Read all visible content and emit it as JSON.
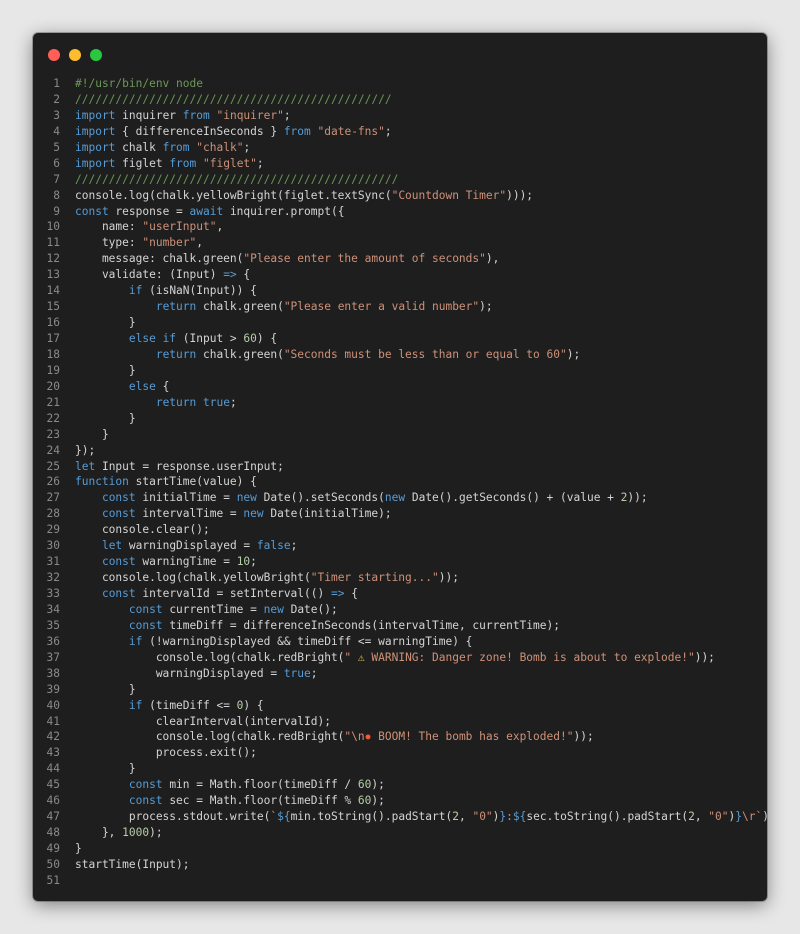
{
  "window": {
    "buttons": [
      {
        "name": "close",
        "color": "#ff5f57"
      },
      {
        "name": "minimize",
        "color": "#febc2e"
      },
      {
        "name": "maximize",
        "color": "#28c840"
      }
    ],
    "background": "#1e1e1e"
  },
  "code": {
    "lines": [
      {
        "num": "1",
        "tokens": [
          {
            "t": "#!/usr/bin/env node",
            "c": "comment"
          }
        ]
      },
      {
        "num": "2",
        "tokens": [
          {
            "t": "///////////////////////////////////////////////",
            "c": "comment"
          }
        ]
      },
      {
        "num": "3",
        "tokens": [
          {
            "t": "import",
            "c": "keyword"
          },
          {
            "t": " inquirer ",
            "c": "plain"
          },
          {
            "t": "from",
            "c": "keyword"
          },
          {
            "t": " ",
            "c": "plain"
          },
          {
            "t": "\"inquirer\"",
            "c": "string"
          },
          {
            "t": ";",
            "c": "plain"
          }
        ]
      },
      {
        "num": "4",
        "tokens": [
          {
            "t": "import",
            "c": "keyword"
          },
          {
            "t": " { differenceInSeconds } ",
            "c": "plain"
          },
          {
            "t": "from",
            "c": "keyword"
          },
          {
            "t": " ",
            "c": "plain"
          },
          {
            "t": "\"date-fns\"",
            "c": "string"
          },
          {
            "t": ";",
            "c": "plain"
          }
        ]
      },
      {
        "num": "5",
        "tokens": [
          {
            "t": "import",
            "c": "keyword"
          },
          {
            "t": " chalk ",
            "c": "plain"
          },
          {
            "t": "from",
            "c": "keyword"
          },
          {
            "t": " ",
            "c": "plain"
          },
          {
            "t": "\"chalk\"",
            "c": "string"
          },
          {
            "t": ";",
            "c": "plain"
          }
        ]
      },
      {
        "num": "6",
        "tokens": [
          {
            "t": "import",
            "c": "keyword"
          },
          {
            "t": " figlet ",
            "c": "plain"
          },
          {
            "t": "from",
            "c": "keyword"
          },
          {
            "t": " ",
            "c": "plain"
          },
          {
            "t": "\"figlet\"",
            "c": "string"
          },
          {
            "t": ";",
            "c": "plain"
          }
        ]
      },
      {
        "num": "7",
        "tokens": [
          {
            "t": "////////////////////////////////////////////////",
            "c": "comment"
          }
        ]
      },
      {
        "num": "8",
        "tokens": [
          {
            "t": "console.log(chalk.yellowBright(figlet.textSync(",
            "c": "plain"
          },
          {
            "t": "\"Countdown Timer\"",
            "c": "string"
          },
          {
            "t": ")));",
            "c": "plain"
          }
        ]
      },
      {
        "num": "9",
        "tokens": [
          {
            "t": "const",
            "c": "keyword"
          },
          {
            "t": " response = ",
            "c": "plain"
          },
          {
            "t": "await",
            "c": "keyword"
          },
          {
            "t": " inquirer.prompt({",
            "c": "plain"
          }
        ]
      },
      {
        "num": "10",
        "tokens": [
          {
            "t": "    name: ",
            "c": "plain"
          },
          {
            "t": "\"userInput\"",
            "c": "string"
          },
          {
            "t": ",",
            "c": "plain"
          }
        ]
      },
      {
        "num": "11",
        "tokens": [
          {
            "t": "    type: ",
            "c": "plain"
          },
          {
            "t": "\"number\"",
            "c": "string"
          },
          {
            "t": ",",
            "c": "plain"
          }
        ]
      },
      {
        "num": "12",
        "tokens": [
          {
            "t": "    message: chalk.green(",
            "c": "plain"
          },
          {
            "t": "\"Please enter the amount of seconds\"",
            "c": "string"
          },
          {
            "t": "),",
            "c": "plain"
          }
        ]
      },
      {
        "num": "13",
        "tokens": [
          {
            "t": "    validate: (Input) ",
            "c": "plain"
          },
          {
            "t": "=>",
            "c": "keyword"
          },
          {
            "t": " {",
            "c": "plain"
          }
        ]
      },
      {
        "num": "14",
        "tokens": [
          {
            "t": "        ",
            "c": "plain"
          },
          {
            "t": "if",
            "c": "control"
          },
          {
            "t": " (isNaN(Input)) {",
            "c": "plain"
          }
        ]
      },
      {
        "num": "15",
        "tokens": [
          {
            "t": "            ",
            "c": "plain"
          },
          {
            "t": "return",
            "c": "control"
          },
          {
            "t": " chalk.green(",
            "c": "plain"
          },
          {
            "t": "\"Please enter a valid number\"",
            "c": "string"
          },
          {
            "t": ");",
            "c": "plain"
          }
        ]
      },
      {
        "num": "16",
        "tokens": [
          {
            "t": "        }",
            "c": "plain"
          }
        ]
      },
      {
        "num": "17",
        "tokens": [
          {
            "t": "        ",
            "c": "plain"
          },
          {
            "t": "else if",
            "c": "control"
          },
          {
            "t": " (Input > ",
            "c": "plain"
          },
          {
            "t": "60",
            "c": "number"
          },
          {
            "t": ") {",
            "c": "plain"
          }
        ]
      },
      {
        "num": "18",
        "tokens": [
          {
            "t": "            ",
            "c": "plain"
          },
          {
            "t": "return",
            "c": "control"
          },
          {
            "t": " chalk.green(",
            "c": "plain"
          },
          {
            "t": "\"Seconds must be less than or equal to 60\"",
            "c": "string"
          },
          {
            "t": ");",
            "c": "plain"
          }
        ]
      },
      {
        "num": "19",
        "tokens": [
          {
            "t": "        }",
            "c": "plain"
          }
        ]
      },
      {
        "num": "20",
        "tokens": [
          {
            "t": "        ",
            "c": "plain"
          },
          {
            "t": "else",
            "c": "control"
          },
          {
            "t": " {",
            "c": "plain"
          }
        ]
      },
      {
        "num": "21",
        "tokens": [
          {
            "t": "            ",
            "c": "plain"
          },
          {
            "t": "return",
            "c": "control"
          },
          {
            "t": " ",
            "c": "plain"
          },
          {
            "t": "true",
            "c": "bool"
          },
          {
            "t": ";",
            "c": "plain"
          }
        ]
      },
      {
        "num": "22",
        "tokens": [
          {
            "t": "        }",
            "c": "plain"
          }
        ]
      },
      {
        "num": "23",
        "tokens": [
          {
            "t": "    }",
            "c": "plain"
          }
        ]
      },
      {
        "num": "24",
        "tokens": [
          {
            "t": "});",
            "c": "plain"
          }
        ]
      },
      {
        "num": "25",
        "tokens": [
          {
            "t": "let",
            "c": "keyword"
          },
          {
            "t": " Input = response.userInput;",
            "c": "plain"
          }
        ]
      },
      {
        "num": "26",
        "tokens": [
          {
            "t": "function",
            "c": "keyword"
          },
          {
            "t": " startTime(value) {",
            "c": "plain"
          }
        ]
      },
      {
        "num": "27",
        "tokens": [
          {
            "t": "    ",
            "c": "plain"
          },
          {
            "t": "const",
            "c": "keyword"
          },
          {
            "t": " initialTime = ",
            "c": "plain"
          },
          {
            "t": "new",
            "c": "keyword"
          },
          {
            "t": " Date().setSeconds(",
            "c": "plain"
          },
          {
            "t": "new",
            "c": "keyword"
          },
          {
            "t": " Date().getSeconds() + (value + ",
            "c": "plain"
          },
          {
            "t": "2",
            "c": "number"
          },
          {
            "t": "));",
            "c": "plain"
          }
        ]
      },
      {
        "num": "28",
        "tokens": [
          {
            "t": "    ",
            "c": "plain"
          },
          {
            "t": "const",
            "c": "keyword"
          },
          {
            "t": " intervalTime = ",
            "c": "plain"
          },
          {
            "t": "new",
            "c": "keyword"
          },
          {
            "t": " Date(initialTime);",
            "c": "plain"
          }
        ]
      },
      {
        "num": "29",
        "tokens": [
          {
            "t": "    console.clear();",
            "c": "plain"
          }
        ]
      },
      {
        "num": "30",
        "tokens": [
          {
            "t": "    ",
            "c": "plain"
          },
          {
            "t": "let",
            "c": "keyword"
          },
          {
            "t": " warningDisplayed = ",
            "c": "plain"
          },
          {
            "t": "false",
            "c": "bool"
          },
          {
            "t": ";",
            "c": "plain"
          }
        ]
      },
      {
        "num": "31",
        "tokens": [
          {
            "t": "    ",
            "c": "plain"
          },
          {
            "t": "const",
            "c": "keyword"
          },
          {
            "t": " warningTime = ",
            "c": "plain"
          },
          {
            "t": "10",
            "c": "number"
          },
          {
            "t": ";",
            "c": "plain"
          }
        ]
      },
      {
        "num": "32",
        "tokens": [
          {
            "t": "    console.log(chalk.yellowBright(",
            "c": "plain"
          },
          {
            "t": "\"Timer starting...\"",
            "c": "string"
          },
          {
            "t": "));",
            "c": "plain"
          }
        ]
      },
      {
        "num": "33",
        "tokens": [
          {
            "t": "    ",
            "c": "plain"
          },
          {
            "t": "const",
            "c": "keyword"
          },
          {
            "t": " intervalId = setInterval(() ",
            "c": "plain"
          },
          {
            "t": "=>",
            "c": "keyword"
          },
          {
            "t": " {",
            "c": "plain"
          }
        ]
      },
      {
        "num": "34",
        "tokens": [
          {
            "t": "        ",
            "c": "plain"
          },
          {
            "t": "const",
            "c": "keyword"
          },
          {
            "t": " currentTime = ",
            "c": "plain"
          },
          {
            "t": "new",
            "c": "keyword"
          },
          {
            "t": " Date();",
            "c": "plain"
          }
        ]
      },
      {
        "num": "35",
        "tokens": [
          {
            "t": "        ",
            "c": "plain"
          },
          {
            "t": "const",
            "c": "keyword"
          },
          {
            "t": " timeDiff = differenceInSeconds(intervalTime, currentTime);",
            "c": "plain"
          }
        ]
      },
      {
        "num": "36",
        "tokens": [
          {
            "t": "        ",
            "c": "plain"
          },
          {
            "t": "if",
            "c": "control"
          },
          {
            "t": " (!warningDisplayed && timeDiff <= warningTime) {",
            "c": "plain"
          }
        ]
      },
      {
        "num": "37",
        "tokens": [
          {
            "t": "            console.log(chalk.redBright(",
            "c": "plain"
          },
          {
            "t": "\" ",
            "c": "string"
          },
          {
            "t": "⚠",
            "c": "emoji"
          },
          {
            "t": " WARNING: Danger zone! Bomb is about to explode!\"",
            "c": "string"
          },
          {
            "t": "));",
            "c": "plain"
          }
        ]
      },
      {
        "num": "38",
        "tokens": [
          {
            "t": "            warningDisplayed = ",
            "c": "plain"
          },
          {
            "t": "true",
            "c": "bool"
          },
          {
            "t": ";",
            "c": "plain"
          }
        ]
      },
      {
        "num": "39",
        "tokens": [
          {
            "t": "        }",
            "c": "plain"
          }
        ]
      },
      {
        "num": "40",
        "tokens": [
          {
            "t": "        ",
            "c": "plain"
          },
          {
            "t": "if",
            "c": "control"
          },
          {
            "t": " (timeDiff <= ",
            "c": "plain"
          },
          {
            "t": "0",
            "c": "number"
          },
          {
            "t": ") {",
            "c": "plain"
          }
        ]
      },
      {
        "num": "41",
        "tokens": [
          {
            "t": "            clearInterval(intervalId);",
            "c": "plain"
          }
        ]
      },
      {
        "num": "42",
        "tokens": [
          {
            "t": "            console.log(chalk.redBright(",
            "c": "plain"
          },
          {
            "t": "\"\\n",
            "c": "string"
          },
          {
            "t": "✸",
            "c": "boom"
          },
          {
            "t": " BOOM! The bomb has exploded!\"",
            "c": "string"
          },
          {
            "t": "));",
            "c": "plain"
          }
        ]
      },
      {
        "num": "43",
        "tokens": [
          {
            "t": "            process.exit();",
            "c": "plain"
          }
        ]
      },
      {
        "num": "44",
        "tokens": [
          {
            "t": "        }",
            "c": "plain"
          }
        ]
      },
      {
        "num": "45",
        "tokens": [
          {
            "t": "        ",
            "c": "plain"
          },
          {
            "t": "const",
            "c": "keyword"
          },
          {
            "t": " min = Math.floor(timeDiff / ",
            "c": "plain"
          },
          {
            "t": "60",
            "c": "number"
          },
          {
            "t": ");",
            "c": "plain"
          }
        ]
      },
      {
        "num": "46",
        "tokens": [
          {
            "t": "        ",
            "c": "plain"
          },
          {
            "t": "const",
            "c": "keyword"
          },
          {
            "t": " sec = Math.floor(timeDiff % ",
            "c": "plain"
          },
          {
            "t": "60",
            "c": "number"
          },
          {
            "t": ");",
            "c": "plain"
          }
        ]
      },
      {
        "num": "47",
        "tokens": [
          {
            "t": "        process.stdout.write(",
            "c": "plain"
          },
          {
            "t": "`",
            "c": "template"
          },
          {
            "t": "${",
            "c": "keyword"
          },
          {
            "t": "min.toString().padStart(",
            "c": "plain"
          },
          {
            "t": "2",
            "c": "number"
          },
          {
            "t": ", ",
            "c": "plain"
          },
          {
            "t": "\"0\"",
            "c": "string"
          },
          {
            "t": ")",
            "c": "plain"
          },
          {
            "t": "}",
            "c": "keyword"
          },
          {
            "t": ":",
            "c": "template"
          },
          {
            "t": "${",
            "c": "keyword"
          },
          {
            "t": "sec.toString().padStart(",
            "c": "plain"
          },
          {
            "t": "2",
            "c": "number"
          },
          {
            "t": ", ",
            "c": "plain"
          },
          {
            "t": "\"0\"",
            "c": "string"
          },
          {
            "t": ")",
            "c": "plain"
          },
          {
            "t": "}",
            "c": "keyword"
          },
          {
            "t": "\\r`",
            "c": "template"
          },
          {
            "t": ");",
            "c": "plain"
          }
        ]
      },
      {
        "num": "48",
        "tokens": [
          {
            "t": "    }, ",
            "c": "plain"
          },
          {
            "t": "1000",
            "c": "number"
          },
          {
            "t": ");",
            "c": "plain"
          }
        ]
      },
      {
        "num": "49",
        "tokens": [
          {
            "t": "}",
            "c": "plain"
          }
        ]
      },
      {
        "num": "50",
        "tokens": [
          {
            "t": "startTime(Input);",
            "c": "plain"
          }
        ]
      },
      {
        "num": "51",
        "tokens": []
      }
    ]
  }
}
